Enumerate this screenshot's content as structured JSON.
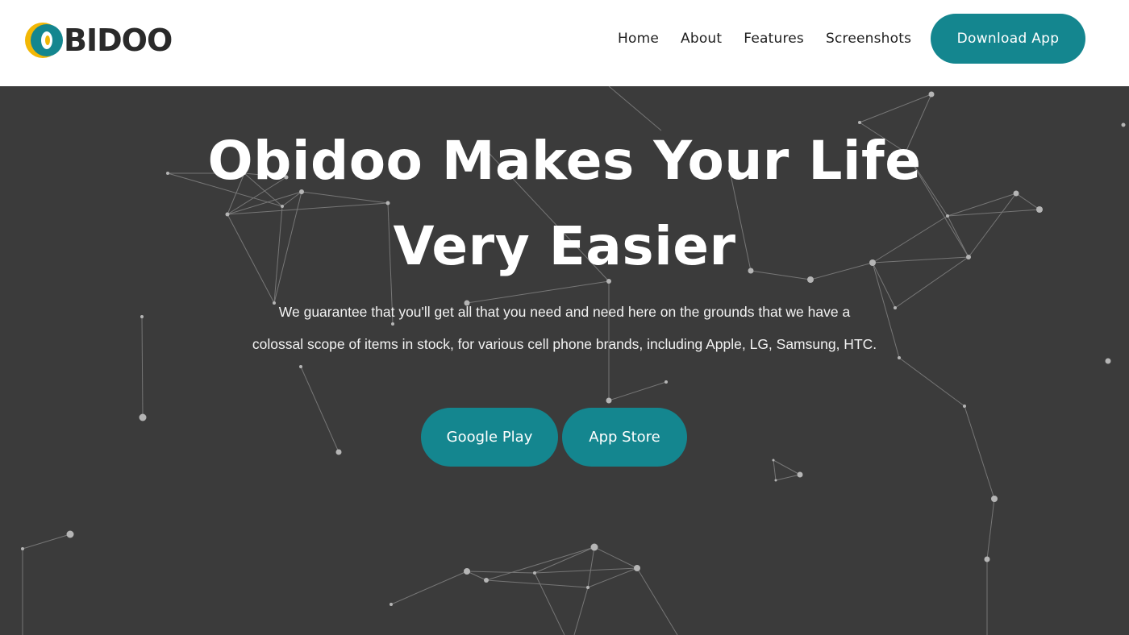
{
  "brand": {
    "logo_text": "BIDOO",
    "logo_accent_colors": [
      "#f2b705",
      "#14868f"
    ]
  },
  "nav": {
    "items": [
      {
        "label": "Home"
      },
      {
        "label": "About"
      },
      {
        "label": "Features"
      },
      {
        "label": "Screenshots"
      }
    ],
    "cta_label": "Download App"
  },
  "hero": {
    "title_line1": "Obidoo Makes Your Life",
    "title_line2": "Very Easier",
    "description_line1": "We guarantee that you'll get all that you need and need here on the grounds that we have a",
    "description_line2": "colossal scope of items in stock, for various cell phone brands, including Apple, LG, Samsung, HTC.",
    "buttons": {
      "google_play": "Google Play",
      "app_store": "App Store"
    }
  },
  "colors": {
    "accent": "#14868f",
    "hero_bg": "#3b3b3b",
    "header_bg": "#ffffff",
    "network_line": "#8a8a8a",
    "network_node": "#b5b5b5"
  }
}
